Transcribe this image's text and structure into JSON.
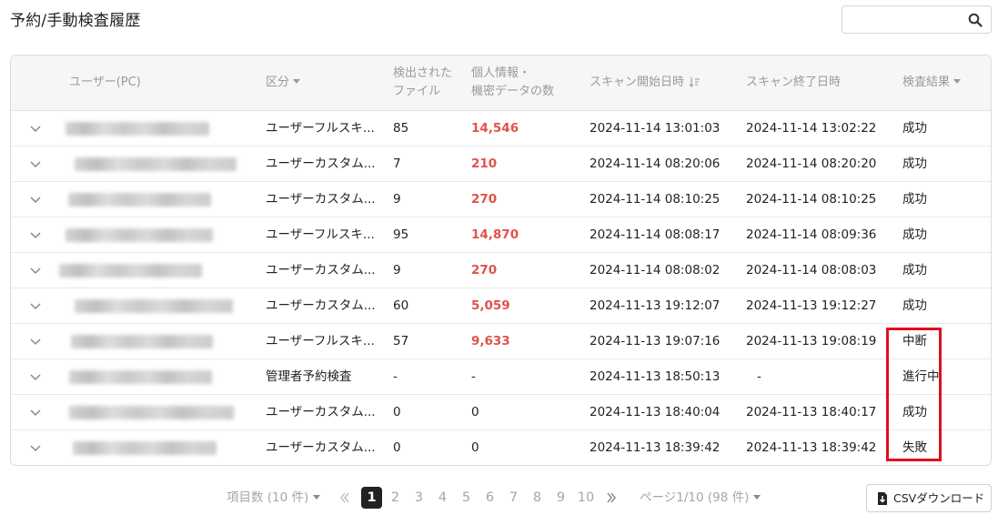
{
  "page": {
    "title": "予約/手動検査履歴"
  },
  "search": {
    "placeholder": "",
    "icon": "search-icon"
  },
  "table": {
    "headers": {
      "user": "ユーザー(PC)",
      "category": "区分",
      "files_line1": "検出された",
      "files_line2": "ファイル",
      "pii_line1": "個人情報・",
      "pii_line2": "機密データの数",
      "scan_start": "スキャン開始日時",
      "scan_end": "スキャン終了日時",
      "result": "検査結果"
    },
    "rows": [
      {
        "category": "ユーザーフルスキ...",
        "files": "85",
        "pii": "14,546",
        "start": "2024-11-14 13:01:03",
        "end": "2024-11-14 13:02:22",
        "result": "成功",
        "pii_highlight": true
      },
      {
        "category": "ユーザーカスタム...",
        "files": "7",
        "pii": "210",
        "start": "2024-11-14 08:20:06",
        "end": "2024-11-14 08:20:20",
        "result": "成功",
        "pii_highlight": true
      },
      {
        "category": "ユーザーカスタム...",
        "files": "9",
        "pii": "270",
        "start": "2024-11-14 08:10:25",
        "end": "2024-11-14 08:10:25",
        "result": "成功",
        "pii_highlight": true
      },
      {
        "category": "ユーザーフルスキ...",
        "files": "95",
        "pii": "14,870",
        "start": "2024-11-14 08:08:17",
        "end": "2024-11-14 08:09:36",
        "result": "成功",
        "pii_highlight": true
      },
      {
        "category": "ユーザーカスタム...",
        "files": "9",
        "pii": "270",
        "start": "2024-11-14 08:08:02",
        "end": "2024-11-14 08:08:03",
        "result": "成功",
        "pii_highlight": true
      },
      {
        "category": "ユーザーカスタム...",
        "files": "60",
        "pii": "5,059",
        "start": "2024-11-13 19:12:07",
        "end": "2024-11-13 19:12:27",
        "result": "成功",
        "pii_highlight": true
      },
      {
        "category": "ユーザーフルスキ...",
        "files": "57",
        "pii": "9,633",
        "start": "2024-11-13 19:07:16",
        "end": "2024-11-13 19:08:19",
        "result": "中断",
        "pii_highlight": true
      },
      {
        "category": "管理者予約検査",
        "files": "-",
        "pii": "-",
        "start": "2024-11-13 18:50:13",
        "end": "-",
        "result": "進行中",
        "pii_highlight": false
      },
      {
        "category": "ユーザーカスタム...",
        "files": "0",
        "pii": "0",
        "start": "2024-11-13 18:40:04",
        "end": "2024-11-13 18:40:17",
        "result": "成功",
        "pii_highlight": false
      },
      {
        "category": "ユーザーカスタム...",
        "files": "0",
        "pii": "0",
        "start": "2024-11-13 18:39:42",
        "end": "2024-11-13 18:39:42",
        "result": "失敗",
        "pii_highlight": false
      }
    ]
  },
  "pagination": {
    "items_per_page": "項目数 (10 件)",
    "pages": [
      "1",
      "2",
      "3",
      "4",
      "5",
      "6",
      "7",
      "8",
      "9",
      "10"
    ],
    "current_page": "1",
    "page_info": "ページ1/10 (98 件)"
  },
  "actions": {
    "csv_download": "CSVダウンロード"
  },
  "colors": {
    "highlight_border": "#e00f1c",
    "pii_value": "#e0524b",
    "active_page": "#222222"
  }
}
